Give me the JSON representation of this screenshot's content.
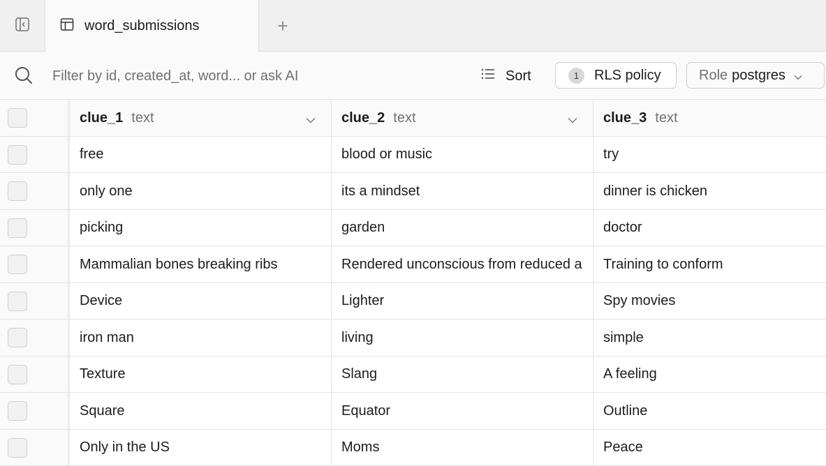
{
  "tabbar": {
    "sidebar_toggle_icon": "sidebar-collapse-icon",
    "tab_icon": "table-icon",
    "tab_label": "word_submissions",
    "add_tab_label": "+"
  },
  "toolbar": {
    "filter_placeholder": "Filter by id, created_at, word... or ask AI",
    "sort_label": "Sort",
    "rls_count": "1",
    "rls_label": "RLS policy",
    "role_prefix": "Role",
    "role_value": "postgres"
  },
  "table": {
    "columns": [
      {
        "name": "clue_1",
        "type": "text"
      },
      {
        "name": "clue_2",
        "type": "text"
      },
      {
        "name": "clue_3",
        "type": "text"
      }
    ],
    "rows": [
      [
        "free",
        "blood or music",
        "try"
      ],
      [
        "only one",
        "its a mindset",
        "dinner is chicken"
      ],
      [
        "picking",
        "garden",
        "doctor"
      ],
      [
        "Mammalian bones breaking ribs",
        "Rendered unconscious from reduced a",
        "Training to conform"
      ],
      [
        "Device",
        "Lighter",
        "Spy movies"
      ],
      [
        "iron man",
        "living",
        "simple"
      ],
      [
        "Texture",
        "Slang",
        "A feeling"
      ],
      [
        "Square",
        "Equator",
        "Outline"
      ],
      [
        "Only in the US",
        "Moms",
        "Peace"
      ]
    ]
  },
  "colors": {
    "tabbar_bg": "#f0f0f0",
    "toolbar_bg": "#fafafa",
    "border": "#e4e4e4",
    "muted_text": "#707070"
  }
}
